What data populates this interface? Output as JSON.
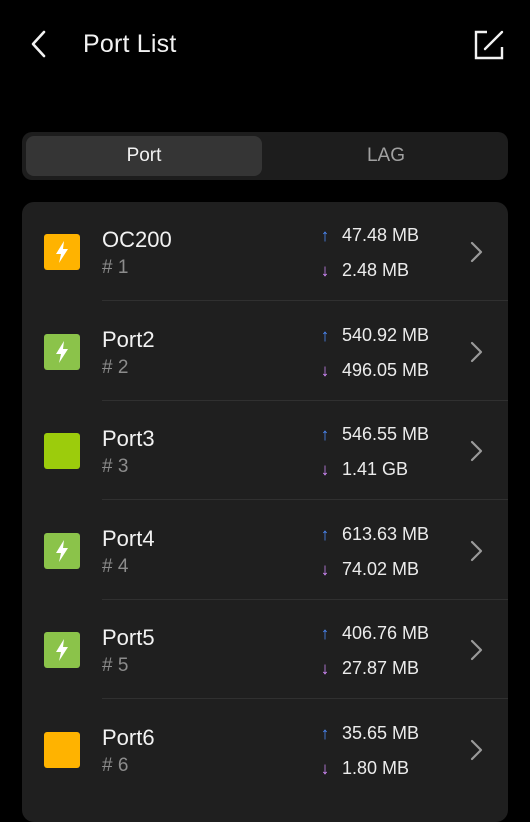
{
  "header": {
    "title": "Port List",
    "back_icon": "chevron-left-icon",
    "edit_icon": "edit-square-icon"
  },
  "tabs": [
    {
      "label": "Port",
      "active": true
    },
    {
      "label": "LAG",
      "active": false
    }
  ],
  "colors": {
    "poe_green": "#8bc34a",
    "status_green": "#9ccc0c",
    "status_orange": "#ffb300",
    "arrow_up": "#4d8dff",
    "arrow_down": "#d68cff"
  },
  "ports": [
    {
      "name": "OC200",
      "number": "# 1",
      "up": "47.48 MB",
      "down": "2.48 MB",
      "status": "orange",
      "poe": true
    },
    {
      "name": "Port2",
      "number": "# 2",
      "up": "540.92 MB",
      "down": "496.05 MB",
      "status": "green",
      "poe": true
    },
    {
      "name": "Port3",
      "number": "# 3",
      "up": "546.55 MB",
      "down": "1.41 GB",
      "status": "green",
      "poe": false
    },
    {
      "name": "Port4",
      "number": "# 4",
      "up": "613.63 MB",
      "down": "74.02 MB",
      "status": "green",
      "poe": true
    },
    {
      "name": "Port5",
      "number": "# 5",
      "up": "406.76 MB",
      "down": "27.87 MB",
      "status": "green",
      "poe": true
    },
    {
      "name": "Port6",
      "number": "# 6",
      "up": "35.65 MB",
      "down": "1.80 MB",
      "status": "orange",
      "poe": false
    }
  ]
}
